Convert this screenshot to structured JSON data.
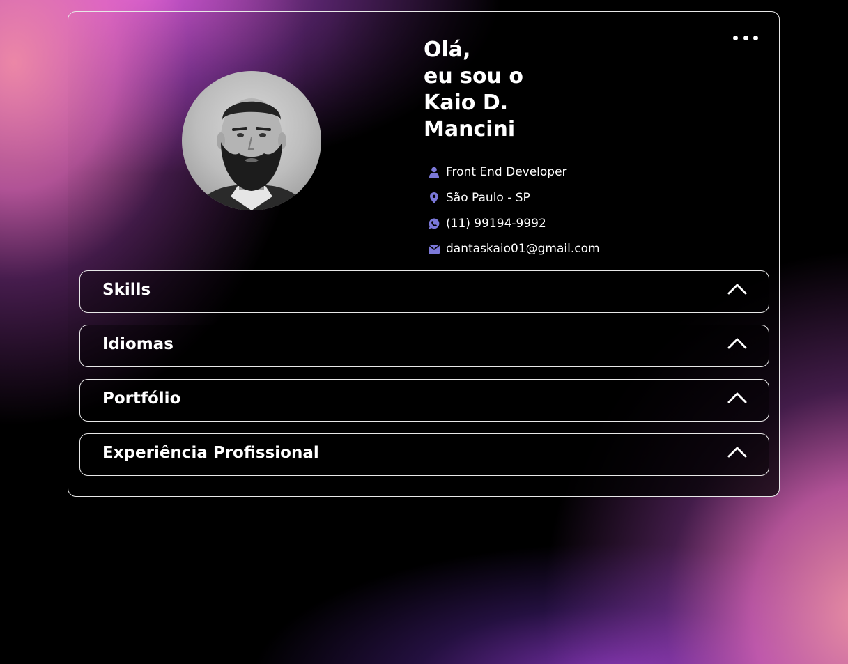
{
  "header": {
    "greeting_lines": [
      "Olá,",
      "eu sou o",
      "Kaio D.",
      "Mancini"
    ]
  },
  "profile": {
    "avatar_icon": "profile-photo",
    "info": [
      {
        "icon": "user-icon",
        "text": "Front End Developer"
      },
      {
        "icon": "location-pin-icon",
        "text": "São Paulo - SP"
      },
      {
        "icon": "whatsapp-icon",
        "text": "(11) 99194-9992"
      },
      {
        "icon": "mail-icon",
        "text": "dantaskaio01@gmail.com"
      }
    ]
  },
  "menu": {
    "icon": "more-dots-icon"
  },
  "sections": [
    {
      "label": "Skills",
      "icon": "chevron-up-icon"
    },
    {
      "label": "Idiomas",
      "icon": "chevron-up-icon"
    },
    {
      "label": "Portfólio",
      "icon": "chevron-up-icon"
    },
    {
      "label": "Experiência Profissional",
      "icon": "chevron-up-icon"
    }
  ],
  "colors": {
    "icon_accent": "#7b78d8",
    "border": "#e8e8e8",
    "gradient_pink": "#f08cb0",
    "gradient_purple": "#a046d8"
  }
}
